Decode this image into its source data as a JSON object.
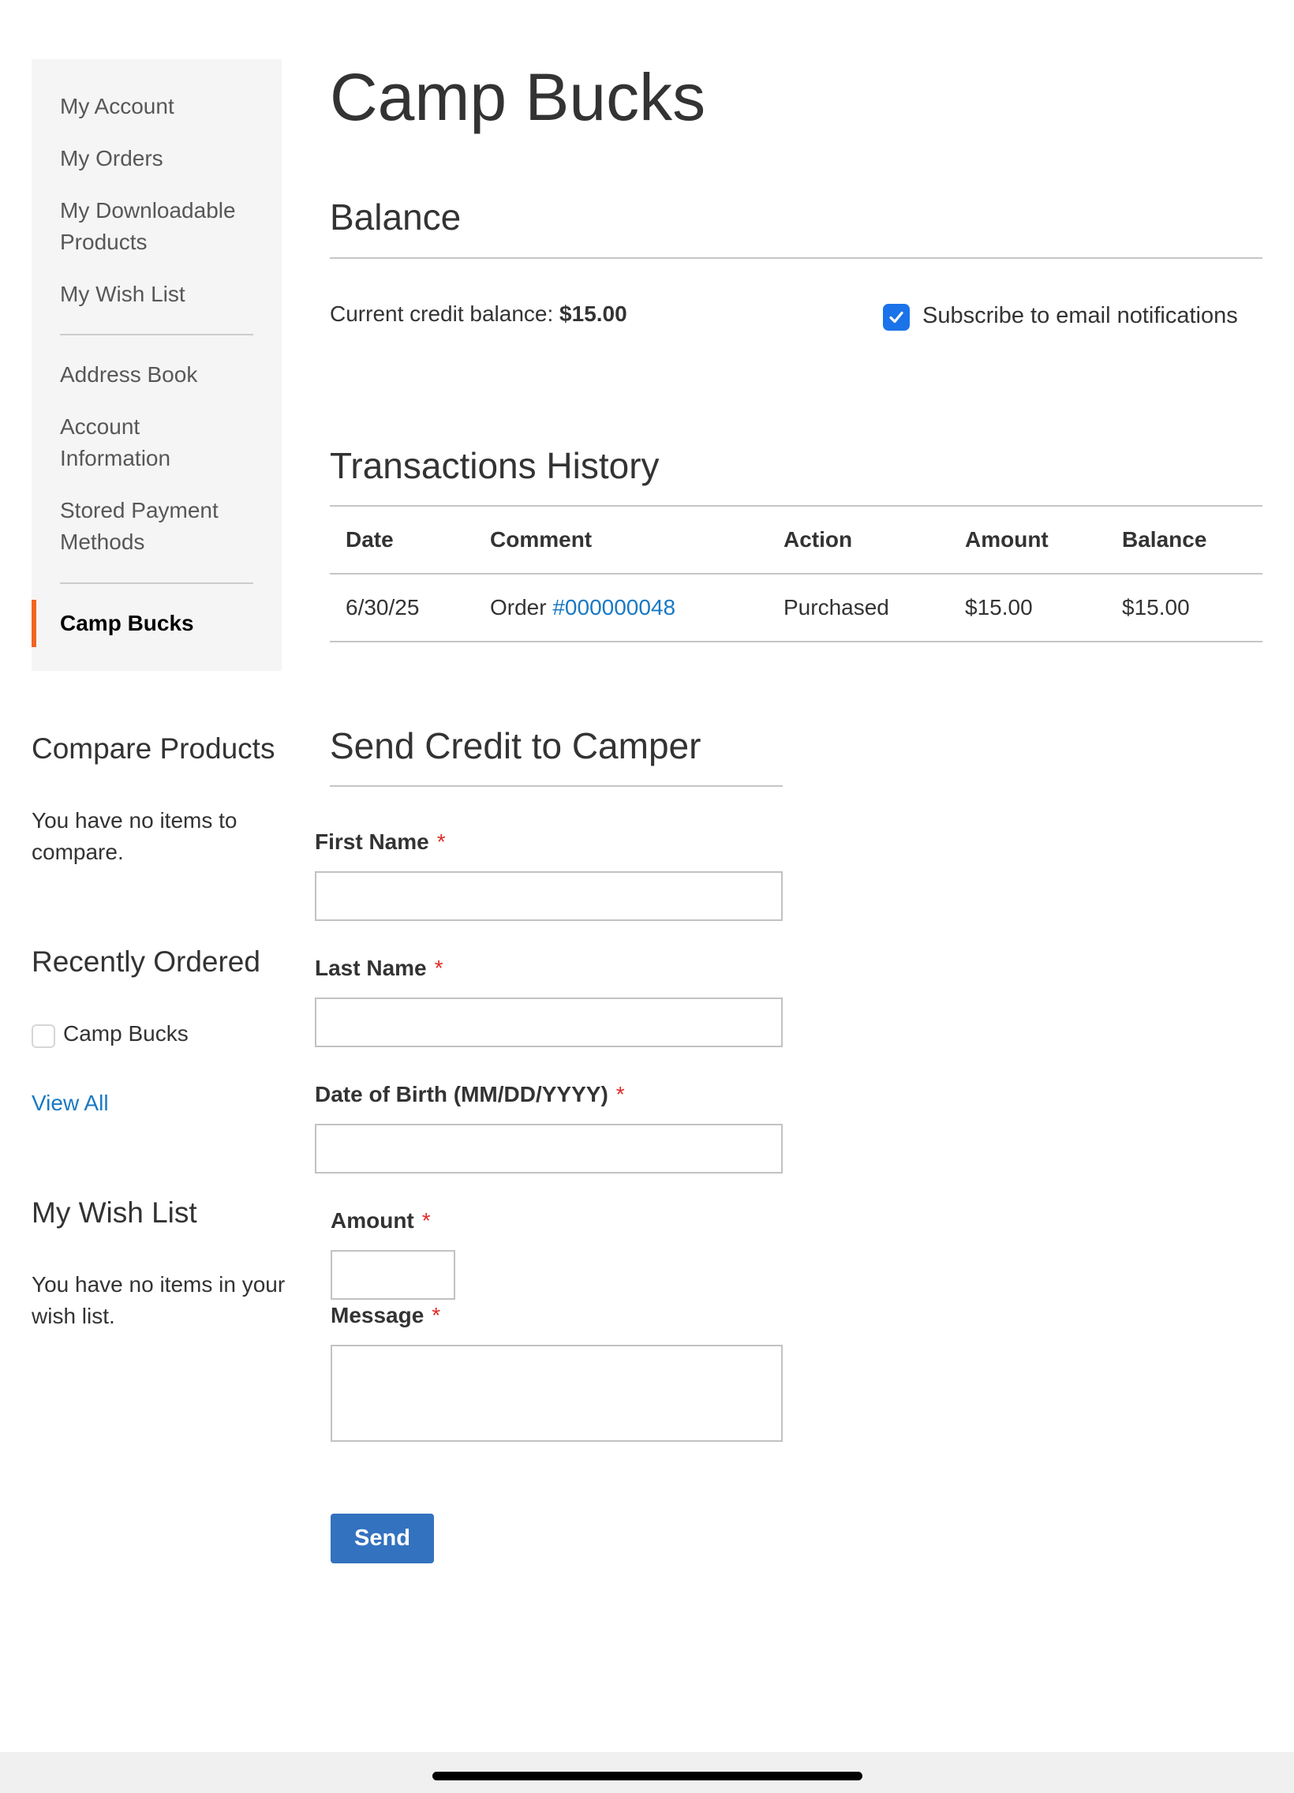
{
  "sidebar": {
    "items": [
      {
        "label": "My Account"
      },
      {
        "label": "My Orders"
      },
      {
        "label": "My Downloadable Products"
      },
      {
        "label": "My Wish List"
      },
      {
        "label": "Address Book"
      },
      {
        "label": "Account Information"
      },
      {
        "label": "Stored Payment Methods"
      },
      {
        "label": "Camp Bucks"
      }
    ],
    "active_item": "Camp Bucks",
    "active_color": "#f26322"
  },
  "compare": {
    "title": "Compare Products",
    "empty_text": "You have no items to compare."
  },
  "recent": {
    "title": "Recently Ordered",
    "item_label": "Camp Bucks",
    "view_all": "View All"
  },
  "wishlist": {
    "title": "My Wish List",
    "empty_text": "You have no items in your wish list."
  },
  "page": {
    "title": "Camp Bucks"
  },
  "balance": {
    "title": "Balance",
    "label": "Current credit balance:",
    "value": "$15.00",
    "subscribe_label": "Subscribe to email notifications",
    "subscribe_checked": true
  },
  "transactions": {
    "title": "Transactions History",
    "headers": [
      "Date",
      "Comment",
      "Action",
      "Amount",
      "Balance"
    ],
    "rows": [
      {
        "date": "6/30/25",
        "comment_prefix": "Order",
        "comment_link": "#000000048",
        "action": "Purchased",
        "amount": "$15.00",
        "balance": "$15.00"
      }
    ]
  },
  "send_credit": {
    "title": "Send Credit to Camper",
    "first_name_label": "First Name",
    "first_name_value": "",
    "last_name_label": "Last Name",
    "last_name_value": "",
    "dob_label": "Date of Birth (MM/DD/YYYY)",
    "dob_value": "",
    "amount_label": "Amount",
    "amount_value": "",
    "message_label": "Message",
    "message_value": "",
    "required_marker": "*",
    "send_label": "Send"
  },
  "colors": {
    "link": "#1979c3",
    "primary_button": "#3372bf",
    "amount_positive": "#36a11e",
    "required": "#e02b27",
    "checkbox": "#1a73e8"
  }
}
